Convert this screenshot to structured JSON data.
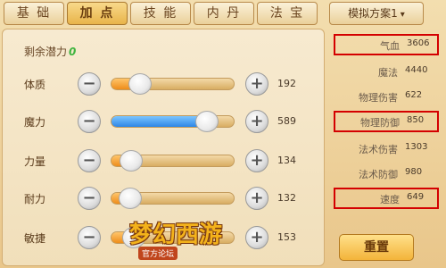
{
  "tabs": [
    {
      "label": "基 础"
    },
    {
      "label": "加 点"
    },
    {
      "label": "技 能"
    },
    {
      "label": "内 丹"
    },
    {
      "label": "法 宝"
    }
  ],
  "scheme": {
    "label": "模拟方案1",
    "chevron": "▾"
  },
  "potential": {
    "label": "剩余潜力",
    "value": "0"
  },
  "attributes": [
    {
      "label": "体质",
      "value": "192",
      "fill": 0.23,
      "color": "#f09018"
    },
    {
      "label": "魔力",
      "value": "589",
      "fill": 0.77,
      "color": "#2d86e6"
    },
    {
      "label": "力量",
      "value": "134",
      "fill": 0.16,
      "color": "#f09018"
    },
    {
      "label": "耐力",
      "value": "132",
      "fill": 0.15,
      "color": "#f09018"
    },
    {
      "label": "敏捷",
      "value": "153",
      "fill": 0.18,
      "color": "#f09018"
    }
  ],
  "stats": [
    {
      "label": "气血",
      "value": "3606",
      "highlight": true
    },
    {
      "label": "魔法",
      "value": "4440",
      "highlight": false
    },
    {
      "label": "物理伤害",
      "value": "622",
      "highlight": false
    },
    {
      "label": "物理防御",
      "value": "850",
      "highlight": true
    },
    {
      "label": "法术伤害",
      "value": "1303",
      "highlight": false
    },
    {
      "label": "法术防御",
      "value": "980",
      "highlight": false
    },
    {
      "label": "速度",
      "value": "649",
      "highlight": true
    }
  ],
  "buttons": {
    "minus": "−",
    "plus": "+",
    "reset": "重置"
  },
  "logo": {
    "main": "梦幻西游",
    "sub": "官方论坛"
  },
  "colors": {
    "highlight_border": "#d40000",
    "potential_value": "#3fb43f"
  }
}
